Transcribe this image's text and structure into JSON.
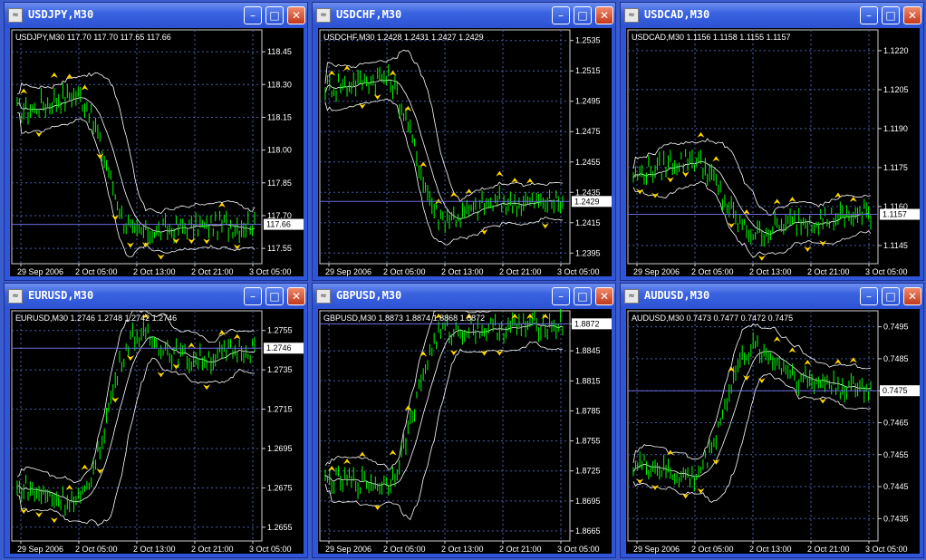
{
  "colors": {
    "candle": "#00ff00",
    "band": "#ffffff",
    "grid": "#4b5ea8",
    "fractal": "#ffd700",
    "bg": "#000000",
    "hline": "#6a6adf"
  },
  "xticks": [
    "29 Sep 2006",
    "2 Oct 05:00",
    "2 Oct 13:00",
    "2 Oct 21:00",
    "3 Oct 05:00"
  ],
  "icons": {
    "app": "chart-window-icon",
    "minimize": "minimize-icon",
    "maximize": "maximize-icon",
    "close": "close-icon"
  },
  "windows": [
    {
      "title": "USDJPY,M30",
      "info": "USDJPY,M30  117.70 117.70 117.65 117.66",
      "yticks": [
        "118.45",
        "118.30",
        "118.15",
        "118.00",
        "117.85",
        "117.70",
        "117.55"
      ],
      "last": "117.66",
      "ylim": [
        117.48,
        118.55
      ],
      "chart_data": {
        "type": "line",
        "title": "USDJPY,M30",
        "x": [
          "29 Sep 2006",
          "2 Oct 05:00",
          "2 Oct 13:00",
          "2 Oct 21:00",
          "3 Oct 05:00"
        ],
        "series": [
          {
            "name": "USDJPY",
            "values": [
              118.18,
              118.25,
              117.62,
              117.65,
              117.66
            ]
          }
        ]
      }
    },
    {
      "title": "USDCHF,M30",
      "info": "USDCHF,M30  1.2428 1.2431 1.2427 1.2429",
      "yticks": [
        "1.2535",
        "1.2515",
        "1.2495",
        "1.2475",
        "1.2455",
        "1.2435",
        "1.2415",
        "1.2395"
      ],
      "last": "1.2429",
      "ylim": [
        1.2388,
        1.2542
      ],
      "chart_data": {
        "type": "line",
        "title": "USDCHF,M30",
        "x": [
          "29 Sep 2006",
          "2 Oct 05:00",
          "2 Oct 13:00",
          "2 Oct 21:00",
          "3 Oct 05:00"
        ],
        "series": [
          {
            "name": "USDCHF",
            "values": [
              1.2505,
              1.251,
              1.2418,
              1.2428,
              1.2429
            ]
          }
        ]
      }
    },
    {
      "title": "USDCAD,M30",
      "info": "USDCAD,M30  1.1156 1.1158 1.1155 1.1157",
      "yticks": [
        "1.1220",
        "1.1205",
        "1.1190",
        "1.1175",
        "1.1160",
        "1.1145"
      ],
      "last": "1.1157",
      "ylim": [
        1.1138,
        1.1228
      ],
      "chart_data": {
        "type": "line",
        "title": "USDCAD,M30",
        "x": [
          "29 Sep 2006",
          "2 Oct 05:00",
          "2 Oct 13:00",
          "2 Oct 21:00",
          "3 Oct 05:00"
        ],
        "series": [
          {
            "name": "USDCAD",
            "values": [
              1.1172,
              1.1178,
              1.115,
              1.1155,
              1.1157
            ]
          }
        ]
      }
    },
    {
      "title": "EURUSD,M30",
      "info": "EURUSD,M30  1.2746 1.2748 1.2742 1.2746",
      "yticks": [
        "1.2755",
        "1.2735",
        "1.2715",
        "1.2695",
        "1.2675",
        "1.2655"
      ],
      "last": "1.2746",
      "ylim": [
        1.2648,
        1.2765
      ],
      "chart_data": {
        "type": "line",
        "title": "EURUSD,M30",
        "x": [
          "29 Sep 2006",
          "2 Oct 05:00",
          "2 Oct 13:00",
          "2 Oct 21:00",
          "3 Oct 05:00"
        ],
        "series": [
          {
            "name": "EURUSD",
            "values": [
              1.2675,
              1.2668,
              1.2752,
              1.274,
              1.2746
            ]
          }
        ]
      }
    },
    {
      "title": "GBPUSD,M30",
      "info": "GBPUSD,M30  1.8873 1.8874 1.8868 1.8872",
      "yticks": [
        "1.8872",
        "1.8845",
        "1.8815",
        "1.8785",
        "1.8755",
        "1.8725",
        "1.8695",
        "1.8665"
      ],
      "last": "1.8872",
      "ylim": [
        1.8655,
        1.8885
      ],
      "chart_data": {
        "type": "line",
        "title": "GBPUSD,M30",
        "x": [
          "29 Sep 2006",
          "2 Oct 05:00",
          "2 Oct 13:00",
          "2 Oct 21:00",
          "3 Oct 05:00"
        ],
        "series": [
          {
            "name": "GBPUSD",
            "values": [
              1.8715,
              1.8712,
              1.8865,
              1.8868,
              1.8872
            ]
          }
        ]
      }
    },
    {
      "title": "AUDUSD,M30",
      "info": "AUDUSD,M30  0.7473 0.7477 0.7472 0.7475",
      "yticks": [
        "0.7495",
        "0.7485",
        "0.7475",
        "0.7465",
        "0.7455",
        "0.7445",
        "0.7435"
      ],
      "last": "0.7475",
      "ylim": [
        0.7428,
        0.75
      ],
      "chart_data": {
        "type": "line",
        "title": "AUDUSD,M30",
        "x": [
          "29 Sep 2006",
          "2 Oct 05:00",
          "2 Oct 13:00",
          "2 Oct 21:00",
          "3 Oct 05:00"
        ],
        "series": [
          {
            "name": "AUDUSD",
            "values": [
              0.7452,
              0.7448,
              0.7488,
              0.7478,
              0.7475
            ]
          }
        ]
      }
    }
  ]
}
